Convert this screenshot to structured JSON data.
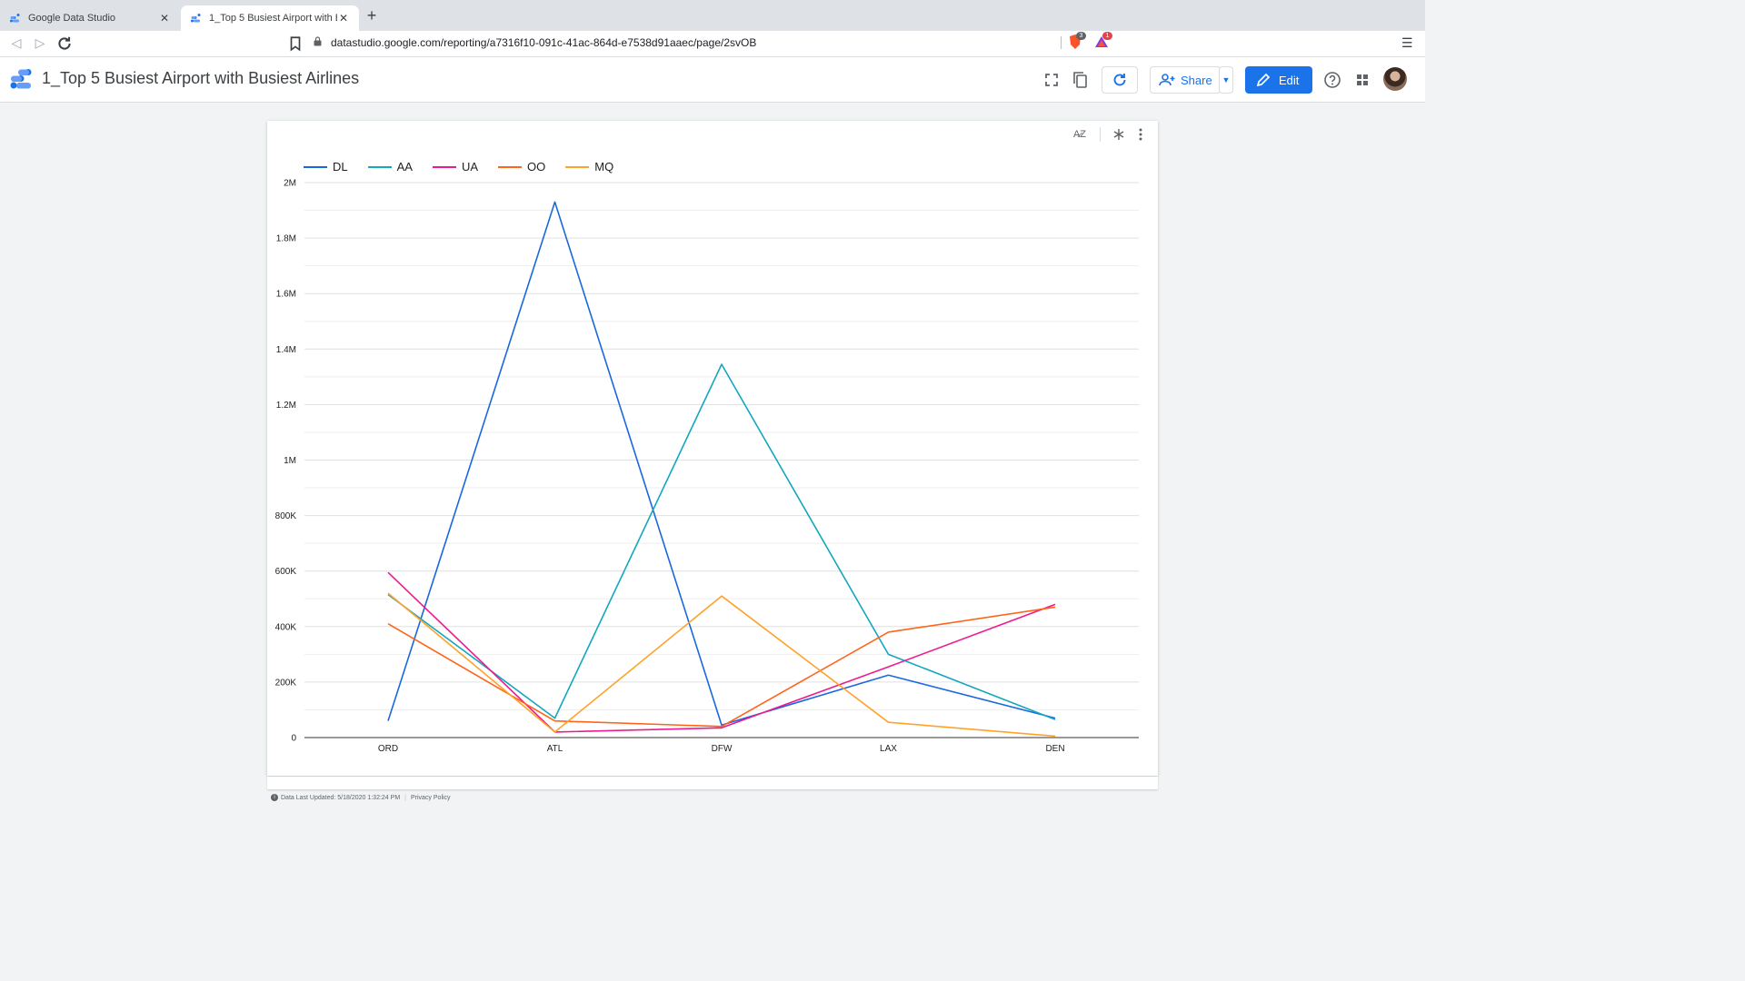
{
  "browser": {
    "tabs": [
      {
        "title": "Google Data Studio",
        "active": false
      },
      {
        "title": "1_Top 5 Busiest Airport with Busiest Airlines",
        "active": true
      }
    ],
    "url": "datastudio.google.com/reporting/a7316f10-091c-41ac-864d-e7538d91aaec/page/2svOB",
    "extensions": [
      {
        "name": "brave-shield-icon",
        "badge": "3"
      },
      {
        "name": "brave-rewards-icon",
        "badge": "1"
      }
    ]
  },
  "header": {
    "title": "1_Top 5 Busiest Airport with Busiest Airlines",
    "share_label": "Share",
    "edit_label": "Edit"
  },
  "footer": {
    "updated": "Data Last Updated: 5/18/2020 1:32:24 PM",
    "privacy": "Privacy Policy"
  },
  "chart_data": {
    "type": "line",
    "categories": [
      "ORD",
      "ATL",
      "DFW",
      "LAX",
      "DEN"
    ],
    "ylim": [
      0,
      2000000
    ],
    "yticks": [
      {
        "value": 0,
        "label": "0"
      },
      {
        "value": 200000,
        "label": "200K"
      },
      {
        "value": 400000,
        "label": "400K"
      },
      {
        "value": 600000,
        "label": "600K"
      },
      {
        "value": 800000,
        "label": "800K"
      },
      {
        "value": 1000000,
        "label": "1M"
      },
      {
        "value": 1200000,
        "label": "1.2M"
      },
      {
        "value": 1400000,
        "label": "1.4M"
      },
      {
        "value": 1600000,
        "label": "1.6M"
      },
      {
        "value": 1800000,
        "label": "1.8M"
      },
      {
        "value": 2000000,
        "label": "2M"
      }
    ],
    "grid": true,
    "legend_position": "top-left",
    "series": [
      {
        "name": "DL",
        "color": "#1a67e0",
        "values": [
          60000,
          1930000,
          45000,
          225000,
          70000
        ]
      },
      {
        "name": "AA",
        "color": "#13a7be",
        "values": [
          515000,
          70000,
          1345000,
          300000,
          65000
        ]
      },
      {
        "name": "UA",
        "color": "#ec1c8f",
        "values": [
          595000,
          20000,
          35000,
          255000,
          480000
        ]
      },
      {
        "name": "OO",
        "color": "#ff6418",
        "values": [
          410000,
          60000,
          40000,
          380000,
          470000
        ]
      },
      {
        "name": "MQ",
        "color": "#ffa229",
        "values": [
          520000,
          20000,
          510000,
          55000,
          5000
        ]
      }
    ]
  }
}
